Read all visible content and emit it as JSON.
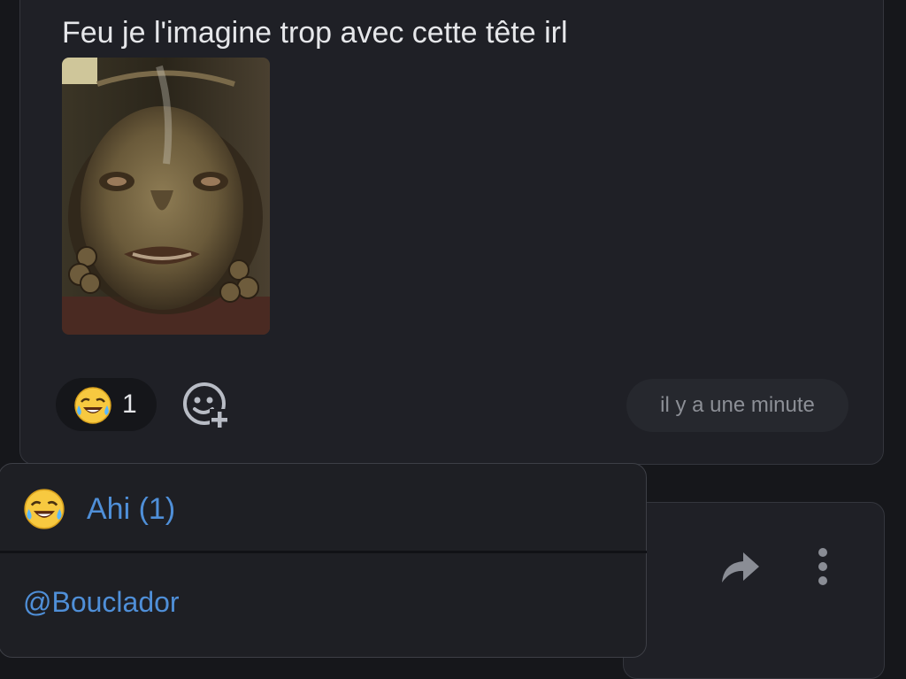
{
  "message": {
    "text": "Feu je l'imagine trop avec cette tête irl",
    "attachment_icon": "photo-of-sculpted-face-mask"
  },
  "reactions": [
    {
      "emoji_icon": "face-with-tears-of-joy-emoji",
      "count": "1"
    }
  ],
  "timestamp": "il y a une minute",
  "reaction_popup": {
    "title": "Ahi (1)",
    "users": [
      "@Bouclador"
    ]
  },
  "colors": {
    "background": "#16171b",
    "card": "#1f2026",
    "link": "#4f8fd8",
    "text": "#e6e7ea",
    "muted": "#8c8f96"
  }
}
